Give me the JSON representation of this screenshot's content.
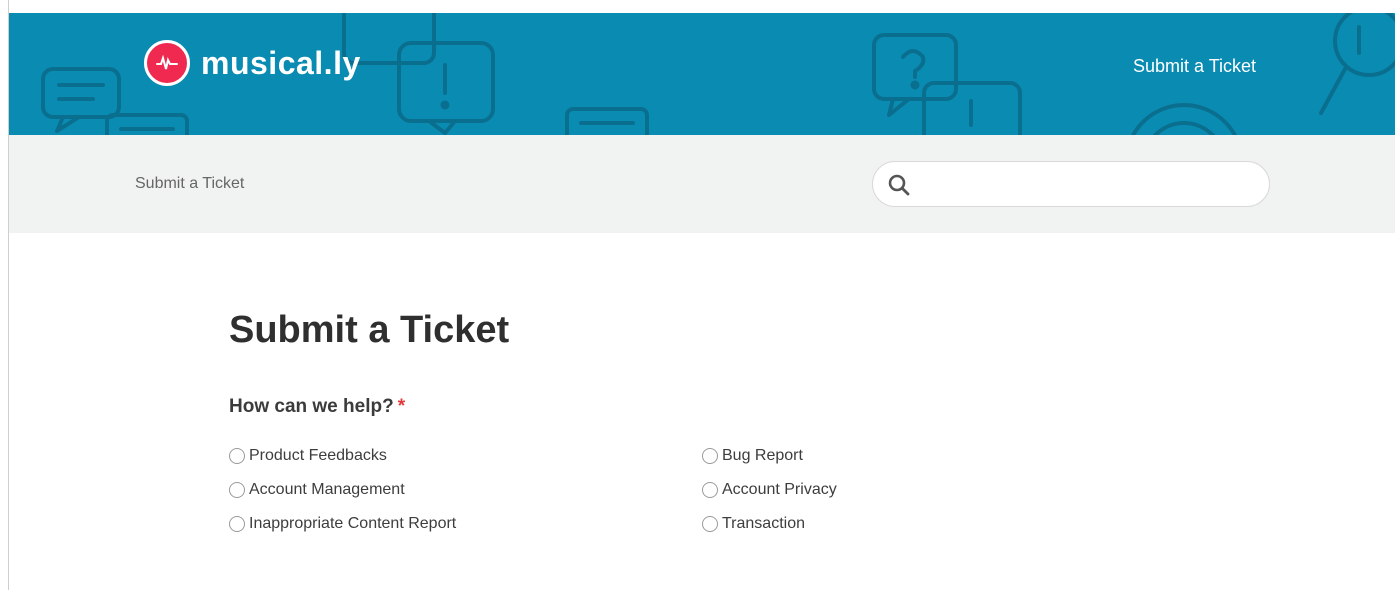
{
  "header": {
    "brand": "musical.ly",
    "nav_link": "Submit a Ticket",
    "bg_color": "#0a8bb2",
    "logo_color": "#ef2950",
    "logo_icon": "soundwave-icon"
  },
  "subbar": {
    "breadcrumb": "Submit a Ticket",
    "search": {
      "value": "",
      "placeholder": "",
      "icon": "search-icon"
    }
  },
  "main": {
    "title": "Submit a Ticket",
    "question": "How can we help?",
    "required_marker": "*",
    "options": [
      {
        "label": "Product Feedbacks",
        "selected": false
      },
      {
        "label": "Account Management",
        "selected": false
      },
      {
        "label": "Inappropriate Content Report",
        "selected": false
      },
      {
        "label": "Bug Report",
        "selected": false
      },
      {
        "label": "Account Privacy",
        "selected": false
      },
      {
        "label": "Transaction",
        "selected": false
      }
    ]
  }
}
